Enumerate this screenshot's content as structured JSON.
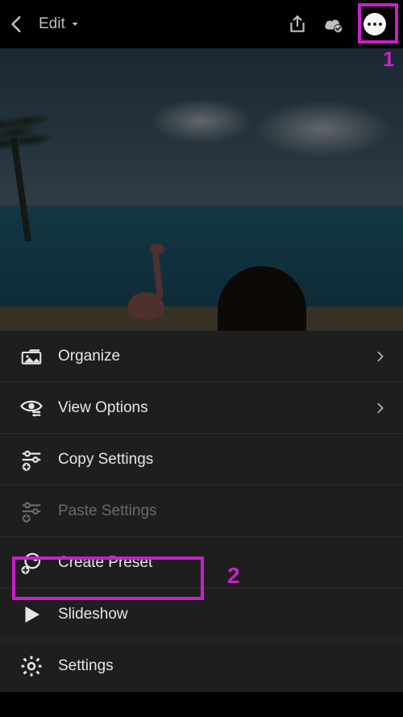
{
  "topbar": {
    "title": "Edit"
  },
  "menu": {
    "items": [
      {
        "key": "organize",
        "label": "Organize",
        "chevron": true,
        "disabled": false
      },
      {
        "key": "view-options",
        "label": "View Options",
        "chevron": true,
        "disabled": false
      },
      {
        "key": "copy-settings",
        "label": "Copy Settings",
        "chevron": false,
        "disabled": false
      },
      {
        "key": "paste-settings",
        "label": "Paste Settings",
        "chevron": false,
        "disabled": true
      },
      {
        "key": "create-preset",
        "label": "Create Preset",
        "chevron": false,
        "disabled": false
      },
      {
        "key": "slideshow",
        "label": "Slideshow",
        "chevron": false,
        "disabled": false
      },
      {
        "key": "settings",
        "label": "Settings",
        "chevron": false,
        "disabled": false
      }
    ]
  },
  "annotations": {
    "label1": "1",
    "label2": "2",
    "highlight_color": "#c920c9"
  }
}
